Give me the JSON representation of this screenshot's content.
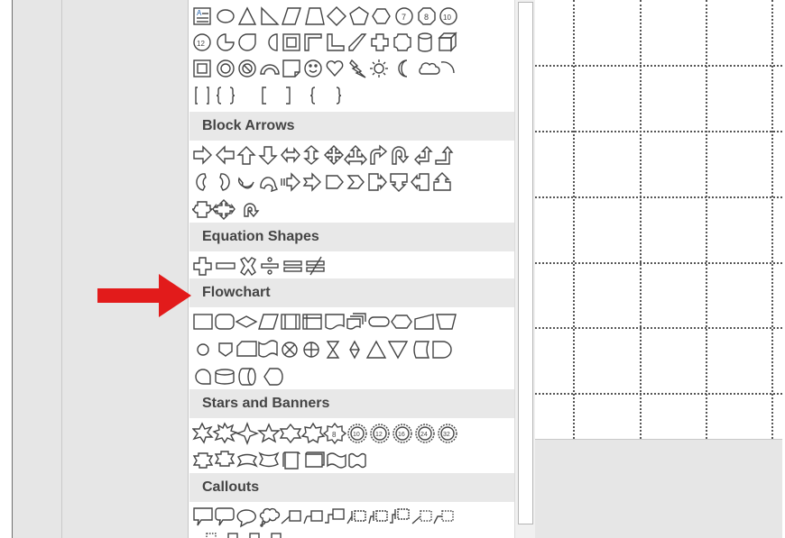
{
  "gallery": {
    "sections": [
      {
        "id": "block-arrows",
        "label": "Block Arrows"
      },
      {
        "id": "equation-shapes",
        "label": "Equation Shapes"
      },
      {
        "id": "flowchart",
        "label": "Flowchart"
      },
      {
        "id": "stars-and-banners",
        "label": "Stars and Banners"
      },
      {
        "id": "callouts",
        "label": "Callouts"
      }
    ],
    "basic_shape_numbers": [
      "7",
      "8",
      "10",
      "12"
    ],
    "star_numbers": [
      "8",
      "10",
      "12",
      "16",
      "24",
      "32"
    ]
  },
  "annotation": {
    "arrow_color": "#e21b1b"
  },
  "colors": {
    "shape_stroke": "#444444",
    "text_icon_blue": "#1f5fa8"
  }
}
